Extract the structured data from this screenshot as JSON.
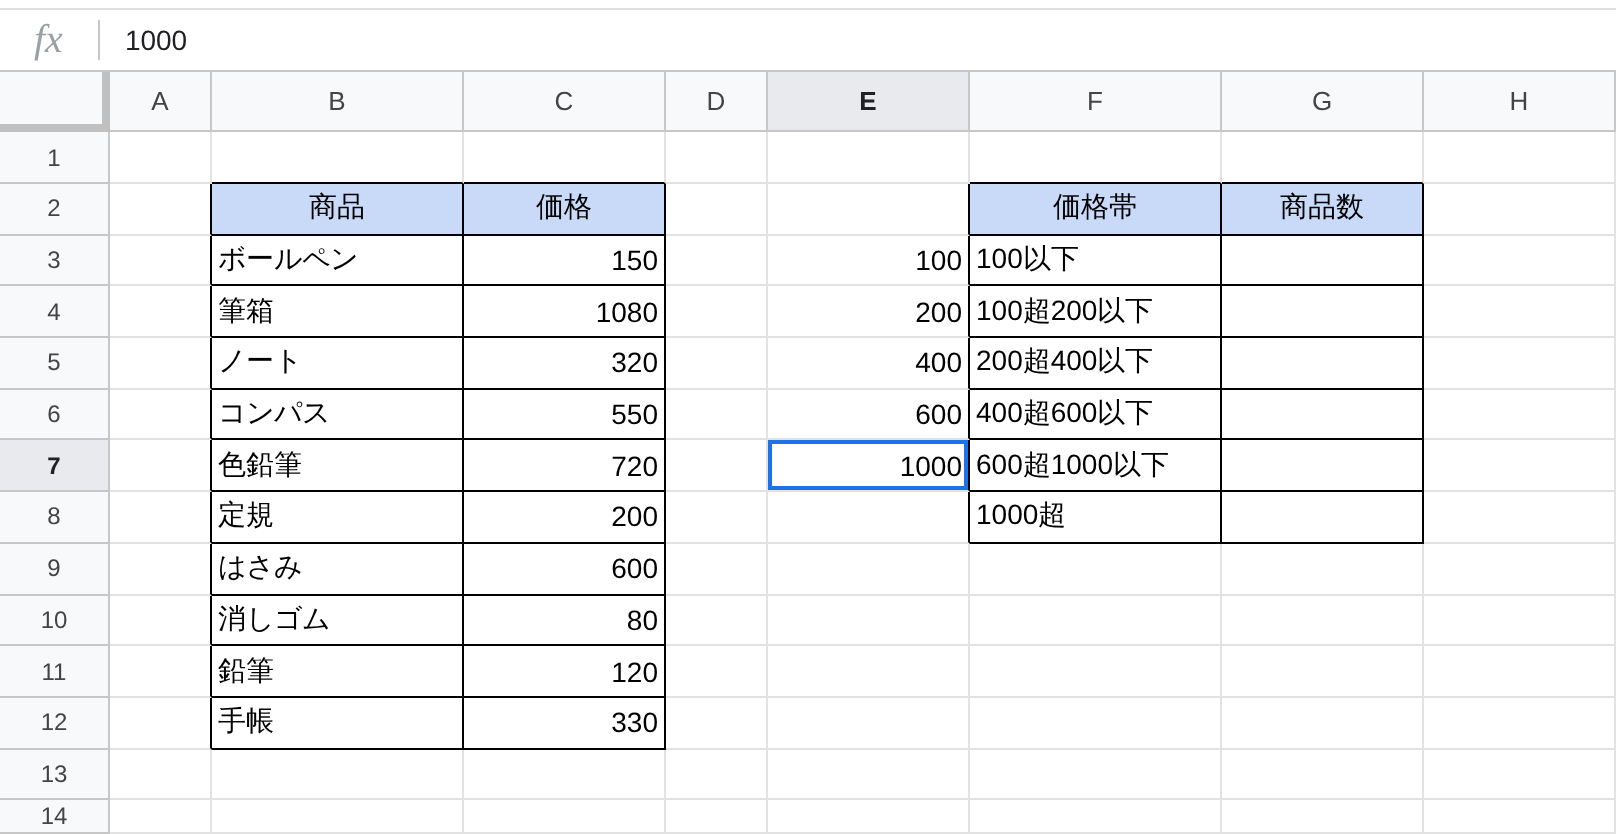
{
  "formula_bar": {
    "icon": "fx",
    "value": "1000"
  },
  "columns": [
    {
      "label": "A",
      "selected": false
    },
    {
      "label": "B",
      "selected": false
    },
    {
      "label": "C",
      "selected": false
    },
    {
      "label": "D",
      "selected": false
    },
    {
      "label": "E",
      "selected": true
    },
    {
      "label": "F",
      "selected": false
    },
    {
      "label": "G",
      "selected": false
    },
    {
      "label": "H",
      "selected": false
    }
  ],
  "rows": [
    {
      "label": "1",
      "selected": false,
      "cells": [
        {
          "kind": "blank",
          "selected": false
        },
        {
          "kind": "blank",
          "selected": false
        },
        {
          "kind": "blank",
          "selected": false
        },
        {
          "kind": "blank",
          "selected": false
        },
        {
          "kind": "blank",
          "selected": false
        },
        {
          "kind": "blank",
          "selected": false
        },
        {
          "kind": "blank",
          "selected": false
        },
        {
          "kind": "blank",
          "selected": false
        }
      ]
    },
    {
      "label": "2",
      "selected": false,
      "cells": [
        {
          "kind": "blank",
          "selected": false
        },
        {
          "kind": "header",
          "text": "商品",
          "selected": false
        },
        {
          "kind": "header",
          "text": "価格",
          "selected": false
        },
        {
          "kind": "blank",
          "selected": false
        },
        {
          "kind": "blank",
          "selected": false
        },
        {
          "kind": "header",
          "text": "価格帯",
          "selected": false
        },
        {
          "kind": "header",
          "text": "商品数",
          "selected": false
        },
        {
          "kind": "blank",
          "selected": false
        }
      ]
    },
    {
      "label": "3",
      "selected": false,
      "cells": [
        {
          "kind": "blank",
          "selected": false
        },
        {
          "kind": "text",
          "text": "ボールペン",
          "selected": false
        },
        {
          "kind": "number",
          "text": "150",
          "selected": false
        },
        {
          "kind": "blank",
          "selected": false
        },
        {
          "kind": "plain-number",
          "text": "100",
          "selected": false
        },
        {
          "kind": "text",
          "text": "100以下",
          "selected": false
        },
        {
          "kind": "empty",
          "selected": false
        },
        {
          "kind": "blank",
          "selected": false
        }
      ]
    },
    {
      "label": "4",
      "selected": false,
      "cells": [
        {
          "kind": "blank",
          "selected": false
        },
        {
          "kind": "text",
          "text": "筆箱",
          "selected": false
        },
        {
          "kind": "number",
          "text": "1080",
          "selected": false
        },
        {
          "kind": "blank",
          "selected": false
        },
        {
          "kind": "plain-number",
          "text": "200",
          "selected": false
        },
        {
          "kind": "text",
          "text": "100超200以下",
          "selected": false
        },
        {
          "kind": "empty",
          "selected": false
        },
        {
          "kind": "blank",
          "selected": false
        }
      ]
    },
    {
      "label": "5",
      "selected": false,
      "cells": [
        {
          "kind": "blank",
          "selected": false
        },
        {
          "kind": "text",
          "text": "ノート",
          "selected": false
        },
        {
          "kind": "number",
          "text": "320",
          "selected": false
        },
        {
          "kind": "blank",
          "selected": false
        },
        {
          "kind": "plain-number",
          "text": "400",
          "selected": false
        },
        {
          "kind": "text",
          "text": "200超400以下",
          "selected": false
        },
        {
          "kind": "empty",
          "selected": false
        },
        {
          "kind": "blank",
          "selected": false
        }
      ]
    },
    {
      "label": "6",
      "selected": false,
      "cells": [
        {
          "kind": "blank",
          "selected": false
        },
        {
          "kind": "text",
          "text": "コンパス",
          "selected": false
        },
        {
          "kind": "number",
          "text": "550",
          "selected": false
        },
        {
          "kind": "blank",
          "selected": false
        },
        {
          "kind": "plain-number",
          "text": "600",
          "selected": false
        },
        {
          "kind": "text",
          "text": "400超600以下",
          "selected": false
        },
        {
          "kind": "empty",
          "selected": false
        },
        {
          "kind": "blank",
          "selected": false
        }
      ]
    },
    {
      "label": "7",
      "selected": true,
      "cells": [
        {
          "kind": "blank",
          "selected": false
        },
        {
          "kind": "text",
          "text": "色鉛筆",
          "selected": false
        },
        {
          "kind": "number",
          "text": "720",
          "selected": false
        },
        {
          "kind": "blank",
          "selected": false
        },
        {
          "kind": "plain-number",
          "text": "1000",
          "selected": true
        },
        {
          "kind": "text",
          "text": "600超1000以下",
          "selected": false
        },
        {
          "kind": "empty",
          "selected": false
        },
        {
          "kind": "blank",
          "selected": false
        }
      ]
    },
    {
      "label": "8",
      "selected": false,
      "cells": [
        {
          "kind": "blank",
          "selected": false
        },
        {
          "kind": "text",
          "text": "定規",
          "selected": false
        },
        {
          "kind": "number",
          "text": "200",
          "selected": false
        },
        {
          "kind": "blank",
          "selected": false
        },
        {
          "kind": "blank",
          "selected": false
        },
        {
          "kind": "text",
          "text": "1000超",
          "selected": false
        },
        {
          "kind": "empty",
          "selected": false
        },
        {
          "kind": "blank",
          "selected": false
        }
      ]
    },
    {
      "label": "9",
      "selected": false,
      "cells": [
        {
          "kind": "blank",
          "selected": false
        },
        {
          "kind": "text",
          "text": "はさみ",
          "selected": false
        },
        {
          "kind": "number",
          "text": "600",
          "selected": false
        },
        {
          "kind": "blank",
          "selected": false
        },
        {
          "kind": "blank",
          "selected": false
        },
        {
          "kind": "blank",
          "selected": false
        },
        {
          "kind": "blank",
          "selected": false
        },
        {
          "kind": "blank",
          "selected": false
        }
      ]
    },
    {
      "label": "10",
      "selected": false,
      "cells": [
        {
          "kind": "blank",
          "selected": false
        },
        {
          "kind": "text",
          "text": "消しゴム",
          "selected": false
        },
        {
          "kind": "number",
          "text": "80",
          "selected": false
        },
        {
          "kind": "blank",
          "selected": false
        },
        {
          "kind": "blank",
          "selected": false
        },
        {
          "kind": "blank",
          "selected": false
        },
        {
          "kind": "blank",
          "selected": false
        },
        {
          "kind": "blank",
          "selected": false
        }
      ]
    },
    {
      "label": "11",
      "selected": false,
      "cells": [
        {
          "kind": "blank",
          "selected": false
        },
        {
          "kind": "text",
          "text": "鉛筆",
          "selected": false
        },
        {
          "kind": "number",
          "text": "120",
          "selected": false
        },
        {
          "kind": "blank",
          "selected": false
        },
        {
          "kind": "blank",
          "selected": false
        },
        {
          "kind": "blank",
          "selected": false
        },
        {
          "kind": "blank",
          "selected": false
        },
        {
          "kind": "blank",
          "selected": false
        }
      ]
    },
    {
      "label": "12",
      "selected": false,
      "cells": [
        {
          "kind": "blank",
          "selected": false
        },
        {
          "kind": "text",
          "text": "手帳",
          "selected": false
        },
        {
          "kind": "number",
          "text": "330",
          "selected": false
        },
        {
          "kind": "blank",
          "selected": false
        },
        {
          "kind": "blank",
          "selected": false
        },
        {
          "kind": "blank",
          "selected": false
        },
        {
          "kind": "blank",
          "selected": false
        },
        {
          "kind": "blank",
          "selected": false
        }
      ]
    },
    {
      "label": "13",
      "selected": false,
      "cells": [
        {
          "kind": "blank",
          "selected": false
        },
        {
          "kind": "blank",
          "selected": false
        },
        {
          "kind": "blank",
          "selected": false
        },
        {
          "kind": "blank",
          "selected": false
        },
        {
          "kind": "blank",
          "selected": false
        },
        {
          "kind": "blank",
          "selected": false
        },
        {
          "kind": "blank",
          "selected": false
        },
        {
          "kind": "blank",
          "selected": false
        }
      ]
    },
    {
      "label": "14",
      "selected": false,
      "cells": [
        {
          "kind": "blank",
          "selected": false
        },
        {
          "kind": "blank",
          "selected": false
        },
        {
          "kind": "blank",
          "selected": false
        },
        {
          "kind": "blank",
          "selected": false
        },
        {
          "kind": "blank",
          "selected": false
        },
        {
          "kind": "blank",
          "selected": false
        },
        {
          "kind": "blank",
          "selected": false
        },
        {
          "kind": "blank",
          "selected": false
        }
      ]
    }
  ]
}
